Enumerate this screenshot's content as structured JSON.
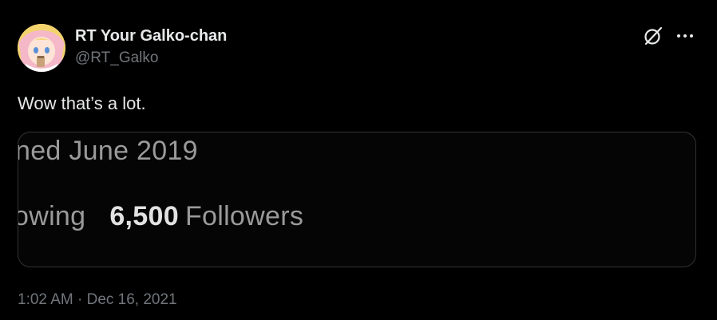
{
  "tweet": {
    "author": {
      "display_name": "RT Your Galko-chan",
      "handle": "@RT_Galko",
      "avatar_icon": "anime-girl-avatar"
    },
    "header_icons": [
      "grok-icon",
      "more-options-icon"
    ],
    "text": "Wow that’s a lot.",
    "media": {
      "line1": "ned June 2019",
      "following_fragment": "owing",
      "followers_count": "6,500",
      "followers_label": "Followers"
    },
    "timestamp": "1:02 AM · Dec 16, 2021"
  },
  "colors": {
    "background": "#000000",
    "primary_text": "#e7e9ea",
    "secondary_text": "#71767b",
    "border": "#2f3336"
  }
}
